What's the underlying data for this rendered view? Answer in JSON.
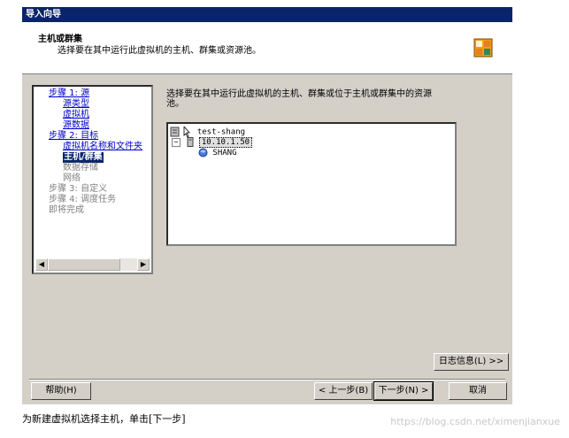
{
  "window": {
    "title": "导入向导"
  },
  "header": {
    "title": "主机或群集",
    "subtitle": "选择要在其中运行此虚拟机的主机、群集或资源池。",
    "icon": "wizard-icon"
  },
  "nav": {
    "items": [
      {
        "label": "步骤 1: 源",
        "state": "link"
      },
      {
        "label": "源类型",
        "state": "link"
      },
      {
        "label": "虚拟机",
        "state": "link"
      },
      {
        "label": "源数据",
        "state": "link"
      },
      {
        "label": "步骤 2: 目标",
        "state": "link"
      },
      {
        "label": "虚拟机名称和文件夹",
        "state": "link"
      },
      {
        "label": "主机/群集",
        "state": "active"
      },
      {
        "label": "数据存储",
        "state": "dim"
      },
      {
        "label": "网络",
        "state": "dim"
      },
      {
        "label": "步骤 3: 自定义",
        "state": "dim"
      },
      {
        "label": "步骤 4: 调度任务",
        "state": "dim"
      },
      {
        "label": "即将完成",
        "state": "dim"
      }
    ]
  },
  "main": {
    "instruction": "选择要在其中运行此虚拟机的主机、群集或位于主机或群集中的资源池。",
    "tree": {
      "root": "test-shang",
      "host": "10.10.1.50",
      "pool": "SHANG"
    }
  },
  "buttons": {
    "log": "日志信息(L) >>",
    "help": "帮助(H)",
    "back": "< 上一步(B)",
    "next": "下一步(N) >",
    "cancel": "取消"
  },
  "caption": "为新建虚拟机选择主机，单击[下一步]",
  "watermark": "https://blog.csdn.net/ximenjianxue"
}
